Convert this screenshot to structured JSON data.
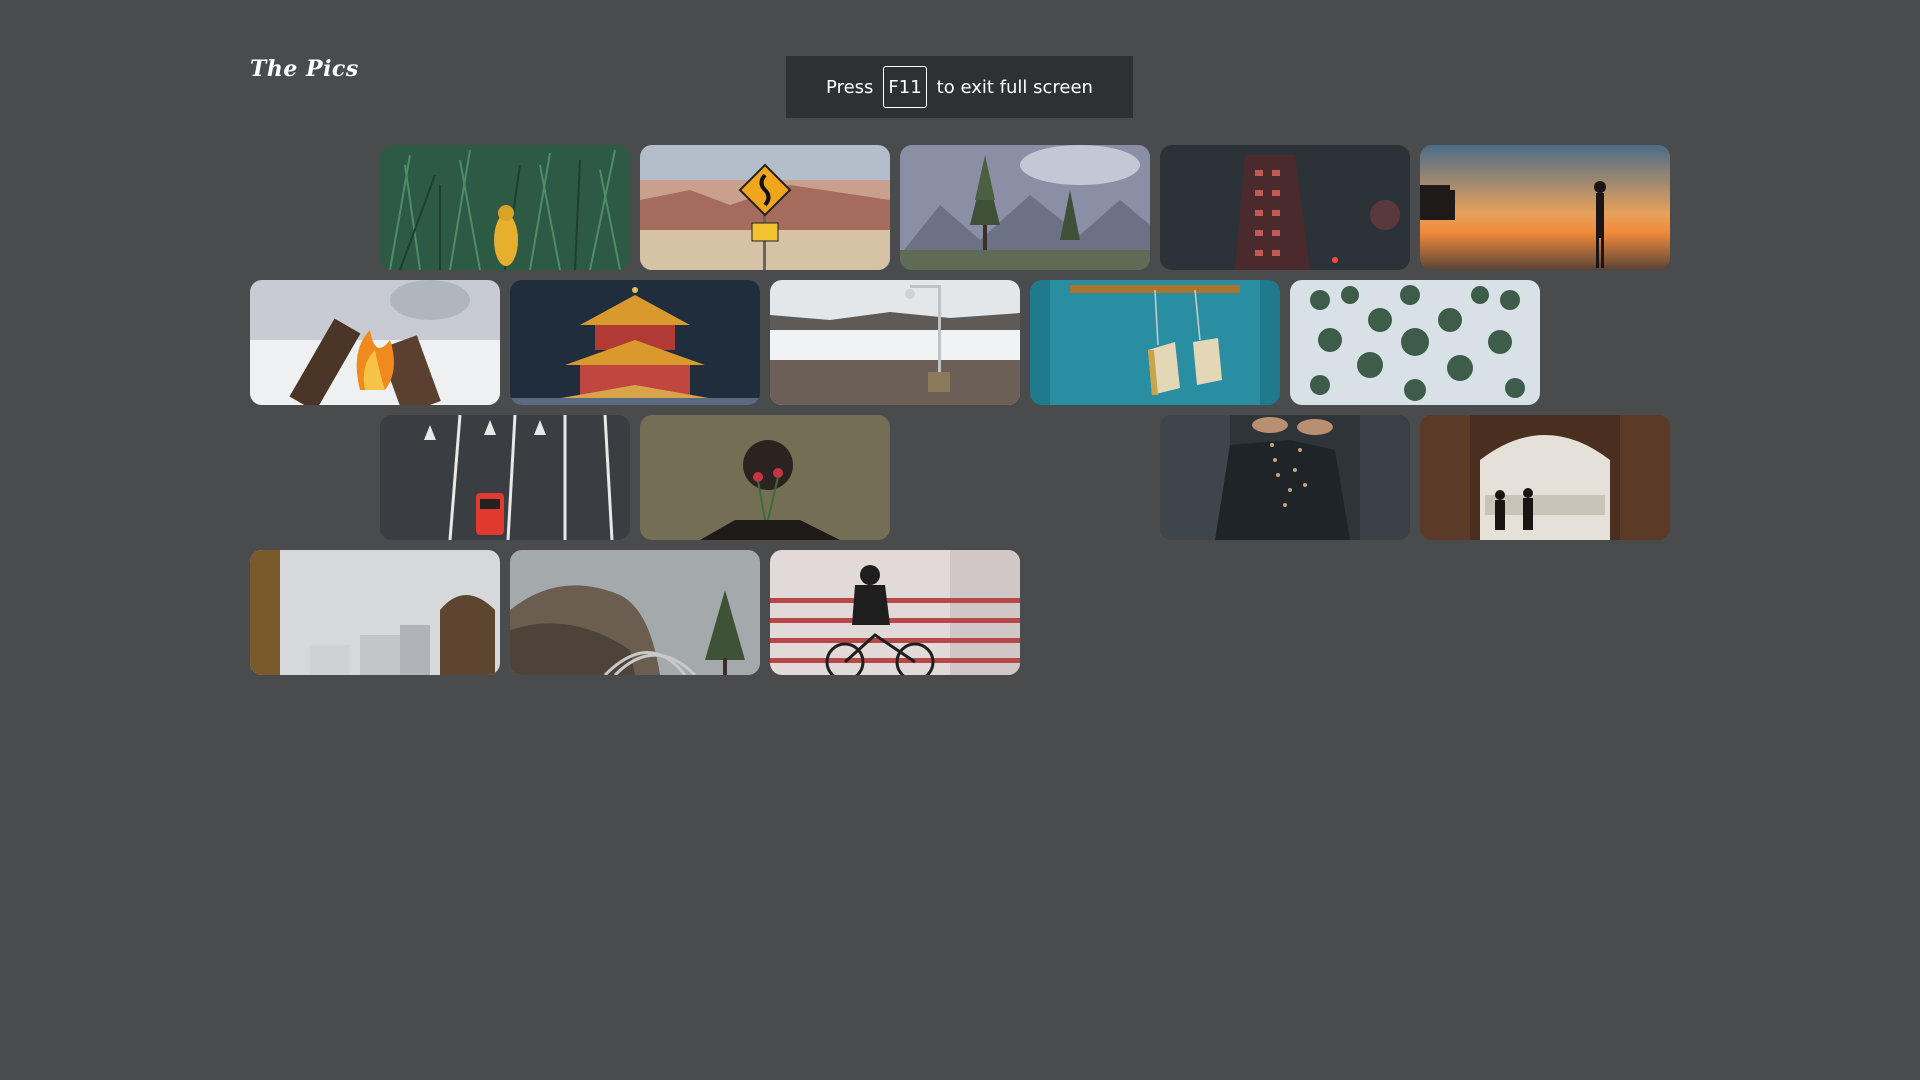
{
  "logo": {
    "text": "The Pics"
  },
  "fullscreen_banner": {
    "prefix": "Press",
    "key": "F11",
    "suffix": "to exit full screen"
  },
  "gallery": {
    "rows": [
      [
        "person-yellow-raincoat-grass",
        "winding-road-sign-desert",
        "pine-trees-mountains",
        "flatiron-building-night",
        "woman-silhouette-pier-sunset"
      ],
      [
        "campfire-snow",
        "chinese-pagoda-night",
        "outdoor-shower-snowy-landscape",
        "hanging-bags-blue-door",
        "aerial-snowy-pine-forest"
      ],
      [
        "red-car-road-arrows",
        "man-hiding-face-flowers",
        "hands-pouring-grains",
        "archway-palace-silhouettes"
      ],
      [
        "city-street-gowings-sign",
        "railway-foggy-cliffs",
        "cyclist-red-railing-bridge"
      ]
    ]
  }
}
